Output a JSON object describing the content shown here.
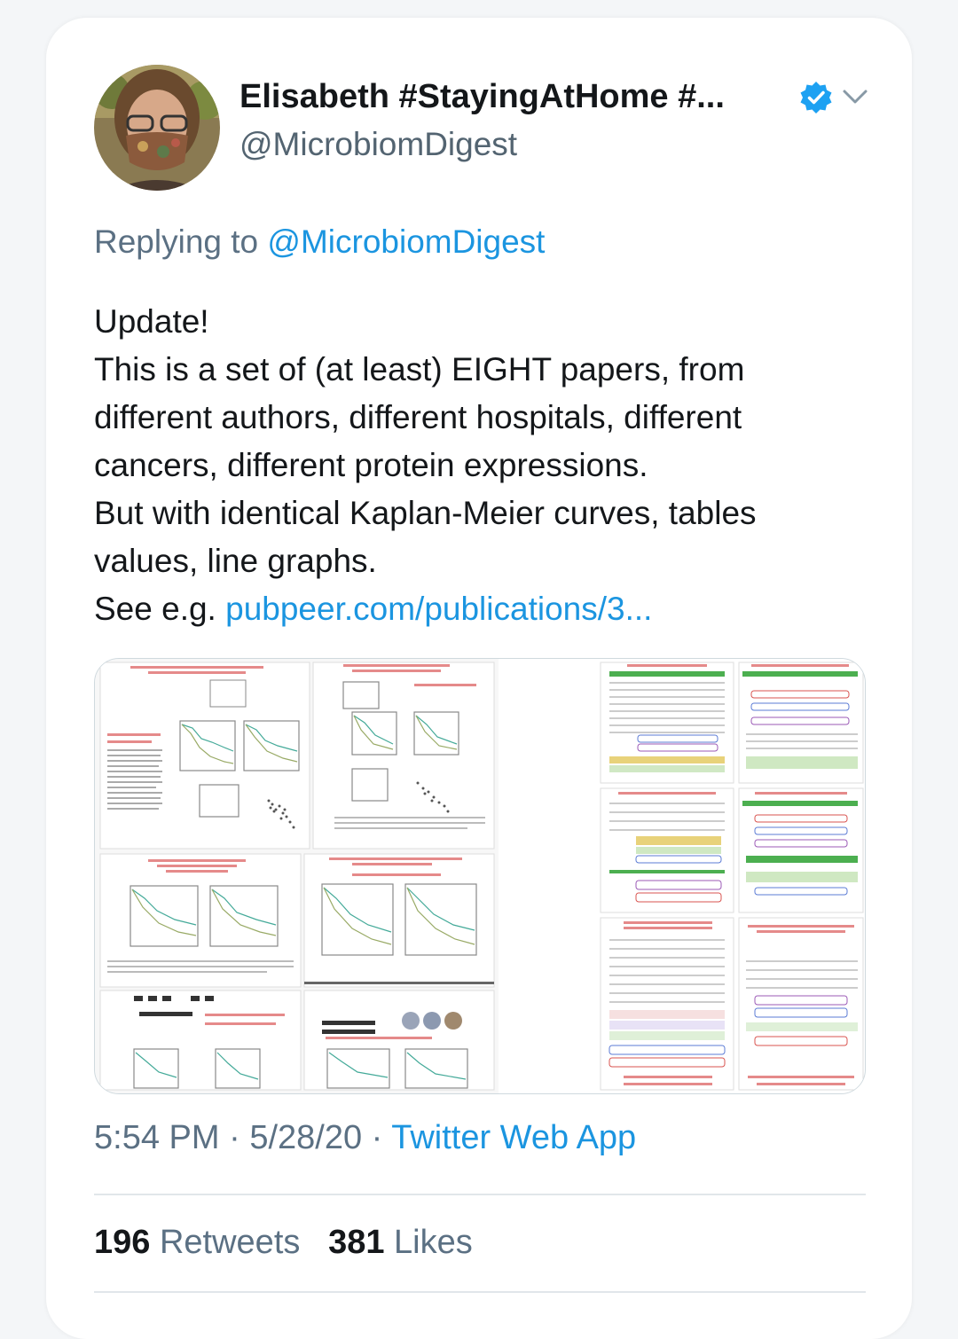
{
  "tweet": {
    "author": {
      "name": "Elisabeth #StayingAtHome #...",
      "handle": "@MicrobiomDigest"
    },
    "replying": {
      "prefix": "Replying to",
      "handle": "@MicrobiomDigest"
    },
    "body": {
      "line1": "Update!",
      "line2": "This is a set of (at least) EIGHT papers, from",
      "line3": "different authors, different hospitals, different",
      "line4": "cancers, different protein expressions.",
      "line5": "But with identical Kaplan-Meier curves, tables",
      "line6": "values, line graphs.",
      "see_prefix": "See e.g.",
      "link": "pubpeer.com/publications/3..."
    },
    "meta": {
      "time": "5:54 PM",
      "separator1": "·",
      "date": "5/28/20",
      "separator2": "·",
      "source": "Twitter Web App"
    },
    "stats": {
      "retweets_count": "196",
      "retweets_label": "Retweets",
      "likes_count": "381",
      "likes_label": "Likes"
    }
  },
  "icons": {
    "verified": "verified-badge-icon",
    "caret": "chevron-down-icon"
  },
  "colors": {
    "link": "#1b95e0",
    "verified": "#1da1f2",
    "text": "#14171a",
    "secondary": "#5b7083"
  }
}
